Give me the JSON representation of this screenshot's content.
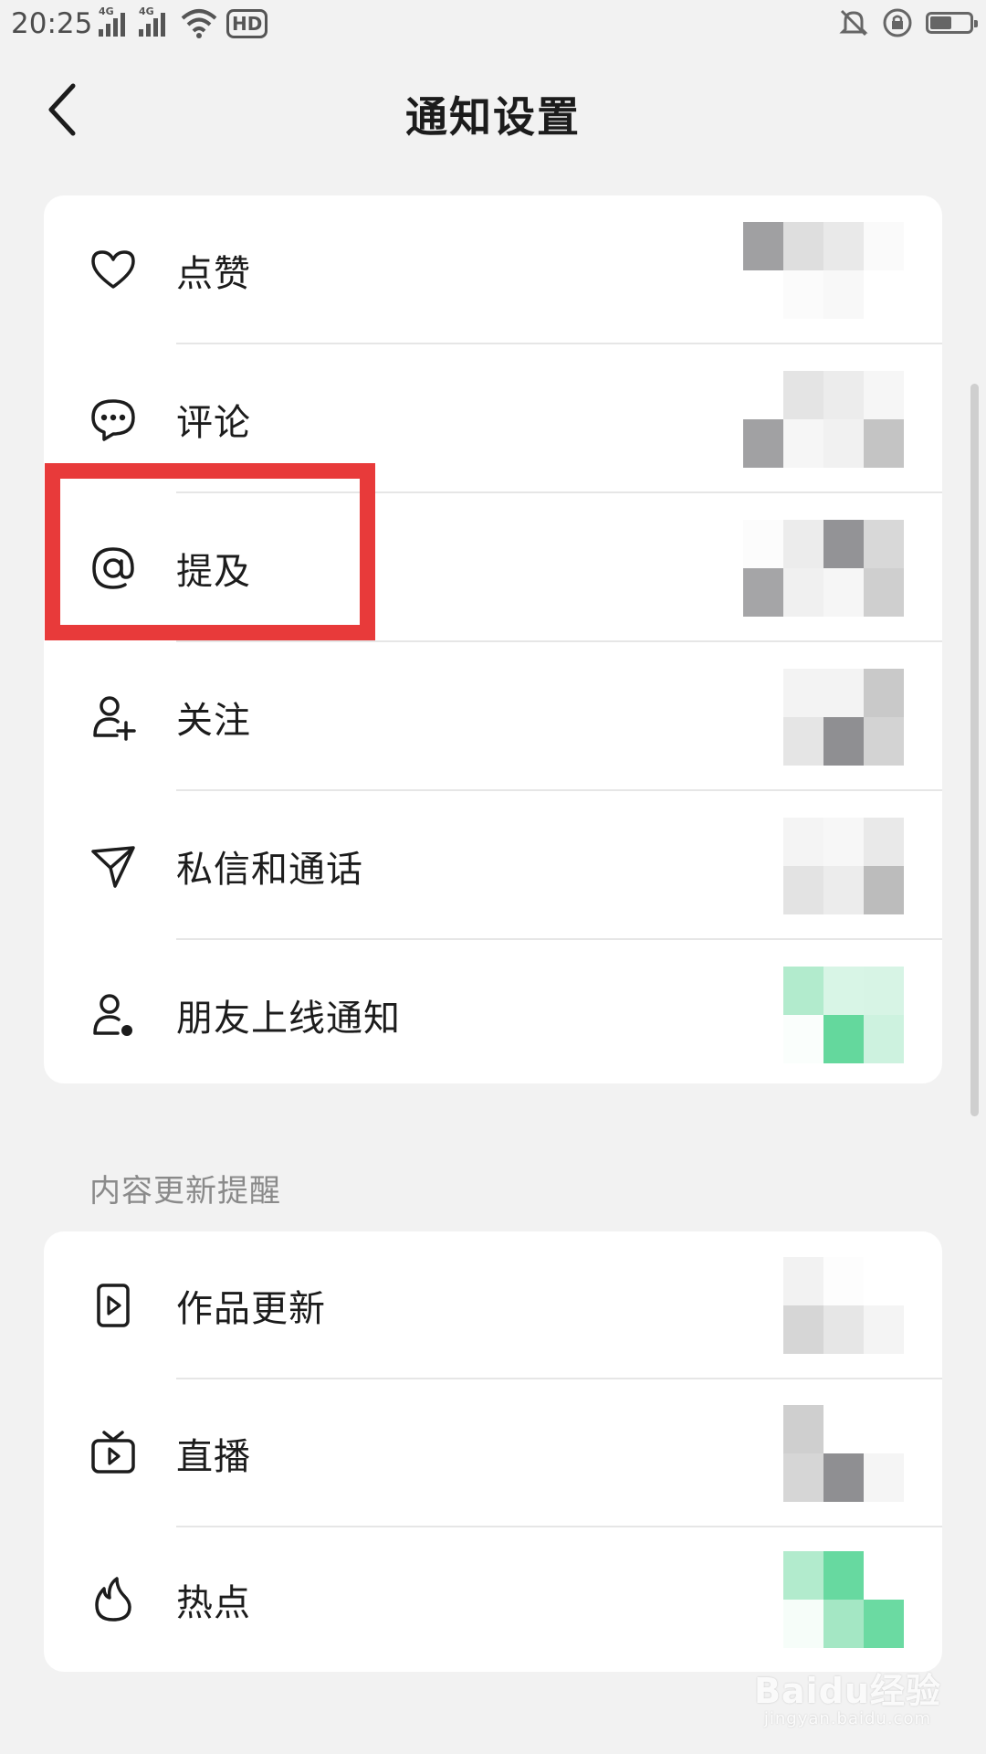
{
  "status_bar": {
    "time": "20:25",
    "signal_1": "4G",
    "signal_2": "4G",
    "hd_label": "HD"
  },
  "header": {
    "title": "通知设置",
    "back_icon": "chevron-left-icon"
  },
  "interaction_section": {
    "items": [
      {
        "label": "点赞",
        "icon": "heart-icon"
      },
      {
        "label": "评论",
        "icon": "chat-bubble-icon"
      },
      {
        "label": "提及",
        "icon": "at-icon"
      },
      {
        "label": "关注",
        "icon": "user-plus-icon"
      },
      {
        "label": "私信和通话",
        "icon": "send-icon"
      },
      {
        "label": "朋友上线通知",
        "icon": "user-online-icon"
      }
    ]
  },
  "content_section": {
    "title": "内容更新提醒",
    "items": [
      {
        "label": "作品更新",
        "icon": "video-icon"
      },
      {
        "label": "直播",
        "icon": "tv-icon"
      },
      {
        "label": "热点",
        "icon": "flame-icon"
      }
    ]
  },
  "colors": {
    "highlight_box": "#e83a3a",
    "toggle_on_green": "#5ed69c",
    "background": "#f2f2f2",
    "card": "#ffffff"
  },
  "watermark": {
    "brand": "Baidu经验",
    "url": "jingyan.baidu.com"
  }
}
